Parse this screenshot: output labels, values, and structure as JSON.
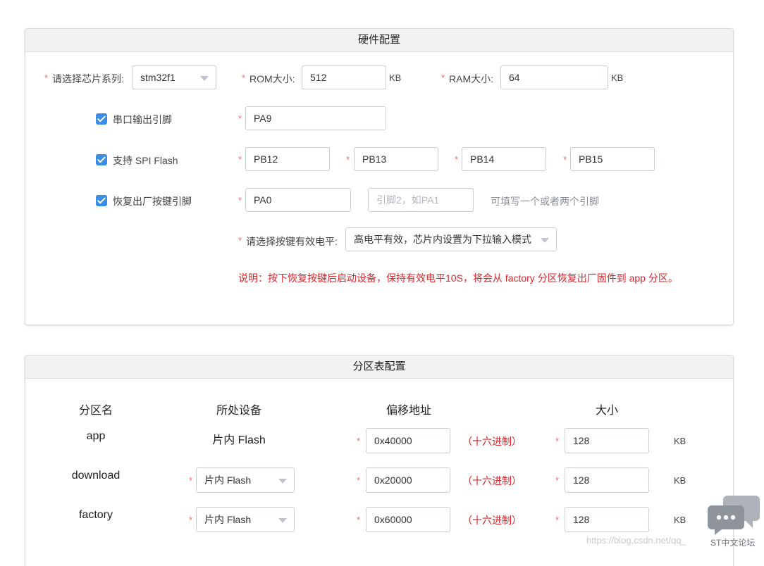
{
  "hardware": {
    "title": "硬件配置",
    "chip_label": "请选择芯片系列:",
    "chip_value": "stm32f1",
    "rom_label": "ROM大小:",
    "rom_value": "512",
    "rom_unit": "KB",
    "ram_label": "RAM大小:",
    "ram_value": "64",
    "ram_unit": "KB",
    "uart_label": "串口输出引脚",
    "uart_pin": "PA9",
    "spi_label": "支持 SPI Flash",
    "spi_pins": [
      "PB12",
      "PB13",
      "PB14",
      "PB15"
    ],
    "restore_label": "恢复出厂按键引脚",
    "restore_pin1": "PA0",
    "restore_pin2_placeholder": "引脚2，如PA1",
    "restore_hint": "可填写一个或者两个引脚",
    "level_label": "请选择按键有效电平:",
    "level_value": "高电平有效，芯片内设置为下拉输入模式",
    "note": "说明：按下恢复按键后启动设备，保持有效电平10S，将会从 factory 分区恢复出厂固件到 app 分区。"
  },
  "partition": {
    "title": "分区表配置",
    "columns": [
      "分区名",
      "所处设备",
      "偏移地址",
      "大小"
    ],
    "hex_label": "（十六进制）",
    "size_unit": "KB",
    "rows": [
      {
        "name": "app",
        "device": "片内 Flash",
        "offset": "0x40000",
        "size": "128"
      },
      {
        "name": "download",
        "device": "片内 Flash",
        "offset": "0x20000",
        "size": "128"
      },
      {
        "name": "factory",
        "device": "片内 Flash",
        "offset": "0x60000",
        "size": "128"
      }
    ]
  },
  "overlay": {
    "watermark": "https://blog.csdn.net/qq_",
    "forum_name": "ST中文论坛"
  }
}
